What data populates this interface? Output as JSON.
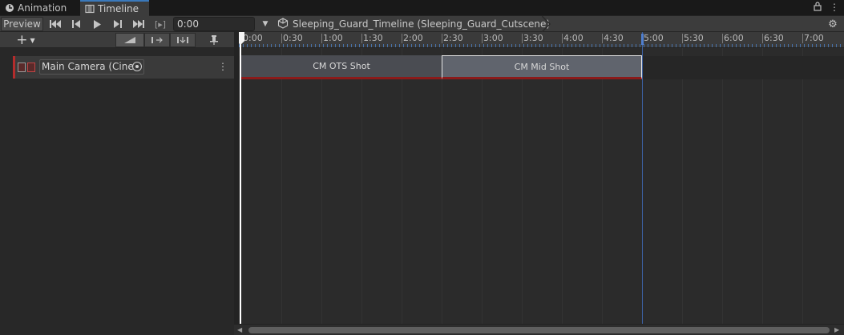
{
  "tabs": [
    {
      "label": "Animation",
      "icon": "animation-clock-icon",
      "active": false
    },
    {
      "label": "Timeline",
      "icon": "timeline-film-icon",
      "active": true
    }
  ],
  "toolbar": {
    "preview_label": "Preview",
    "time_value": "0:00",
    "frame_toggle_label": "[▸]",
    "breadcrumb": "Sleeping_Guard_Timeline (Sleeping_Guard_Cutscene)"
  },
  "track": {
    "name": "Main Camera (Cine"
  },
  "ruler": {
    "labels": [
      "0:00",
      "0:30",
      "1:00",
      "1:30",
      "2:00",
      "2:30",
      "3:00",
      "3:30",
      "4:00",
      "4:30",
      "5:00",
      "5:30",
      "6:00",
      "6:30",
      "7:00"
    ]
  },
  "clips": [
    {
      "label": "CM OTS Shot",
      "start": "0:00",
      "end": "2:30",
      "selected": false
    },
    {
      "label": "CM Mid Shot",
      "start": "2:30",
      "end": "5:00",
      "selected": true
    }
  ],
  "playhead_time": "0:00",
  "end_time": "5:00",
  "colors": {
    "accent": "#3a79bb",
    "track_color": "#b42c2c",
    "clip_underline": "#8b1a1a"
  }
}
